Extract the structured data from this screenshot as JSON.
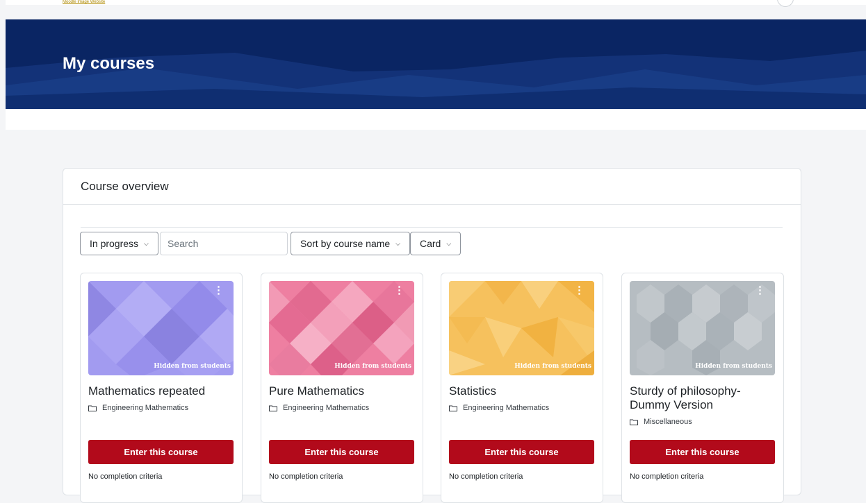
{
  "header": {
    "logo_text": "Moodle Image Website"
  },
  "page": {
    "title": "My courses"
  },
  "overview": {
    "title": "Course overview",
    "filter_label": "In progress",
    "search_placeholder": "Search",
    "sort_label": "Sort by course name",
    "view_label": "Card"
  },
  "courses": [
    {
      "name": "Mathematics repeated",
      "category": "Engineering Mathematics",
      "badge": "Hidden from students",
      "button": "Enter this course",
      "completion": "No completion criteria",
      "color": "#a29bf0"
    },
    {
      "name": "Pure Mathematics",
      "category": "Engineering Mathematics",
      "badge": "Hidden from students",
      "button": "Enter this course",
      "completion": "No completion criteria",
      "color": "#ee7fa1"
    },
    {
      "name": "Statistics",
      "category": "Engineering Mathematics",
      "badge": "Hidden from students",
      "button": "Enter this course",
      "completion": "No completion criteria",
      "color": "#f6c15d"
    },
    {
      "name": "Sturdy of philosophy- Dummy Version",
      "category": "Miscellaneous",
      "badge": "Hidden from students",
      "button": "Enter this course",
      "completion": "No completion criteria",
      "color": "#b6bdc2"
    }
  ],
  "colors": {
    "hero": "#0a2563",
    "button": "#b20a1b",
    "page_bg": "#f4f5f7"
  }
}
